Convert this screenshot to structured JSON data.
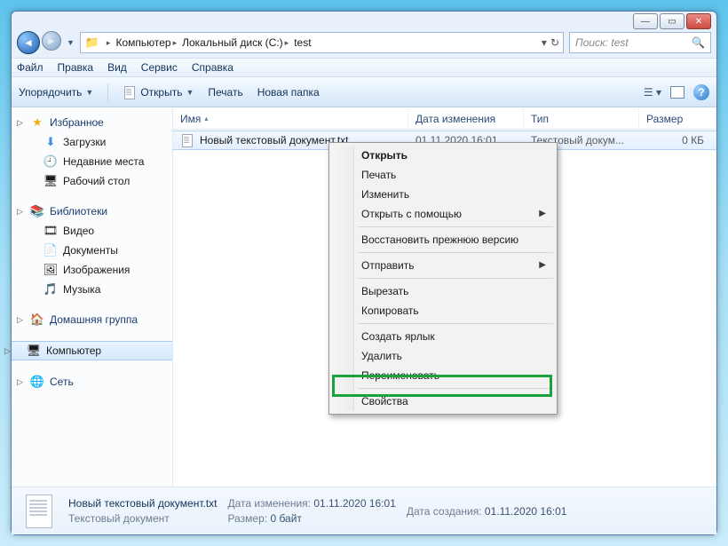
{
  "titlebar": {
    "min": "—",
    "max": "▭",
    "close": "✕"
  },
  "address": {
    "crumbs": [
      "Компьютер",
      "Локальный диск (C:)",
      "test"
    ],
    "search_placeholder": "Поиск: test"
  },
  "menubar": [
    "Файл",
    "Правка",
    "Вид",
    "Сервис",
    "Справка"
  ],
  "toolbar": {
    "organize": "Упорядочить",
    "open": "Открыть",
    "print": "Печать",
    "new_folder": "Новая папка"
  },
  "sidebar": {
    "favorites": {
      "label": "Избранное",
      "items": [
        "Загрузки",
        "Недавние места",
        "Рабочий стол"
      ]
    },
    "libraries": {
      "label": "Библиотеки",
      "items": [
        "Видео",
        "Документы",
        "Изображения",
        "Музыка"
      ]
    },
    "homegroup": "Домашняя группа",
    "computer": "Компьютер",
    "network": "Сеть"
  },
  "columns": {
    "name": "Имя",
    "date": "Дата изменения",
    "type": "Тип",
    "size": "Размер"
  },
  "file": {
    "name": "Новый текстовый документ.txt",
    "date": "01.11.2020 16:01",
    "type": "Текстовый докум...",
    "size": "0 КБ"
  },
  "context_menu": {
    "open": "Открыть",
    "print": "Печать",
    "edit": "Изменить",
    "open_with": "Открыть с помощью",
    "restore": "Восстановить прежнюю версию",
    "send_to": "Отправить",
    "cut": "Вырезать",
    "copy": "Копировать",
    "shortcut": "Создать ярлык",
    "delete": "Удалить",
    "rename": "Переименовать",
    "properties": "Свойства"
  },
  "details": {
    "name": "Новый текстовый документ.txt",
    "subtitle": "Текстовый документ",
    "date_label": "Дата изменения:",
    "date": "01.11.2020 16:01",
    "size_label": "Размер:",
    "size": "0 байт",
    "created_label": "Дата создания:",
    "created": "01.11.2020 16:01"
  }
}
